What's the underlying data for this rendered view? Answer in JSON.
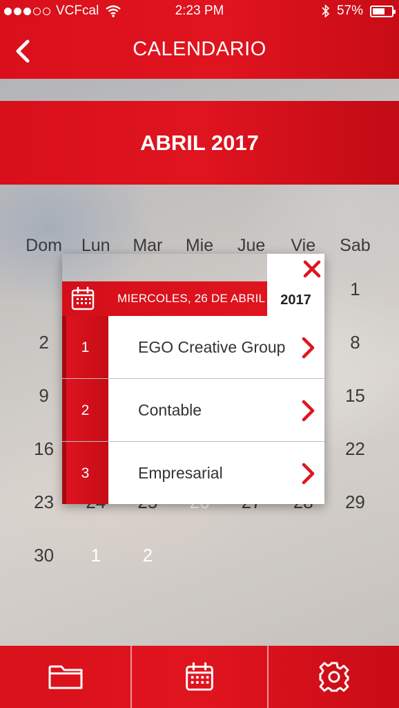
{
  "status_bar": {
    "carrier": "VCFcal",
    "time": "2:23 PM",
    "battery": "57%",
    "battery_level": 0.57,
    "signal_dots_filled": 3,
    "signal_dots_total": 5
  },
  "header": {
    "title": "CALENDARIO",
    "back_icon": "chevron-left-icon"
  },
  "month": {
    "title": "ABRIL 2017"
  },
  "calendar": {
    "weekdays": [
      "Dom",
      "Lun",
      "Mar",
      "Mie",
      "Jue",
      "Vie",
      "Sab"
    ],
    "weeks": [
      [
        "",
        "",
        "",
        "",
        "",
        "",
        "1"
      ],
      [
        "2",
        "",
        "",
        "",
        "",
        "",
        "8"
      ],
      [
        "9",
        "",
        "",
        "",
        "",
        "",
        "15"
      ],
      [
        "16",
        "",
        "",
        "",
        "",
        "",
        "22"
      ],
      [
        "23",
        "24",
        "25",
        "26",
        "27",
        "28",
        "29"
      ],
      [
        "30",
        "1",
        "2",
        "",
        "",
        "",
        ""
      ]
    ],
    "selected_day": "26",
    "accent_color": "#e0131d"
  },
  "popup": {
    "date_label": "MIERCOLES, 26 DE ABRIL",
    "year": "2017",
    "close_icon": "close-icon",
    "calendar_icon": "calendar-icon",
    "events": [
      {
        "number": "1",
        "name": "EGO Creative Group"
      },
      {
        "number": "2",
        "name": "Contable"
      },
      {
        "number": "3",
        "name": "Empresarial"
      }
    ]
  },
  "tabbar": {
    "tabs": [
      {
        "icon": "folder-icon"
      },
      {
        "icon": "calendar-icon"
      },
      {
        "icon": "gear-icon"
      }
    ]
  },
  "colors": {
    "primary_red": "#e0141f",
    "dark_red": "#c50c16"
  }
}
